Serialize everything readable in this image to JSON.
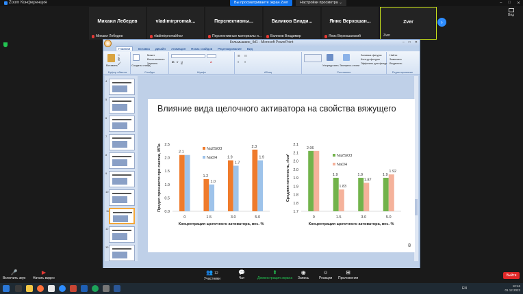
{
  "zoom": {
    "app_title": "Zoom Конференция",
    "share_banner": "Вы просматриваете экран Zver",
    "view_options": "Настройки просмотра ⌄",
    "view_label": "Вид",
    "participants": [
      {
        "display": "Михаил Лебедев",
        "name": "Михаил Лебедев",
        "muted": true
      },
      {
        "display": "vladimirpromak...",
        "name": "vladimirpromakhov",
        "muted": true
      },
      {
        "display": "Перспективны...",
        "name": "Перспективные материалы и...",
        "muted": true
      },
      {
        "display": "Валиков Влади...",
        "name": "Валиков Владимир",
        "muted": true
      },
      {
        "display": "Янис Верхошан...",
        "name": "Янис Верхошанский",
        "muted": true
      },
      {
        "display": "Zver",
        "name": "Zver",
        "muted": false
      }
    ],
    "controls": {
      "unmute": "Включить звук",
      "start_video": "Начать видео",
      "participants": "Участники",
      "participants_count": "12",
      "chat": "Чат",
      "share": "Демонстрация экрана",
      "record": "Запись",
      "reactions": "Реакции",
      "apps": "Приложения",
      "leave": "Выйти"
    }
  },
  "powerpoint": {
    "window_title": "Кольмышкин_4d1 - Microsoft PowerPoint",
    "tabs": [
      "Главная",
      "Вставка",
      "Дизайн",
      "Анимация",
      "Показ слайдов",
      "Рецензирование",
      "Вид"
    ],
    "ribbon": {
      "paste": "Вставить",
      "cut": "Вырезать",
      "copy": "Копировать",
      "format": "Формат по образцу",
      "clipboard_group": "Буфер обмена",
      "create_slide": "Создать слайд",
      "layout": "Макет",
      "reset": "Восстановить",
      "delete": "Удалить",
      "slides_group": "Слайды",
      "font_group": "Шрифт",
      "paragraph_group": "Абзац",
      "arrange": "Упорядочить",
      "quick_styles": "Экспресс-стили",
      "fill": "Заливка фигуры",
      "outline": "Контур фигуры",
      "effects": "Эффекты для фигур",
      "drawing_group": "Рисование",
      "find": "Найти",
      "replace": "Заменить",
      "select": "Выделить",
      "editing_group": "Редактирование"
    },
    "slide_numbers": [
      "4",
      "5",
      "6",
      "7",
      "8",
      "9",
      "10",
      "11",
      "12",
      "13",
      "14"
    ],
    "selected_slide": "11"
  },
  "slide": {
    "title": "Влияние вида щелочного активатора на свойства вяжущего",
    "number": "8"
  },
  "chart_data": [
    {
      "type": "bar",
      "categories": [
        "0",
        "1.5",
        "3.0",
        "5.0"
      ],
      "series": [
        {
          "name": "Na2SiO3",
          "values": [
            2.1,
            1.2,
            1.9,
            2.3
          ],
          "color": "#ef7b2c"
        },
        {
          "name": "NaOH",
          "values": [
            2.1,
            1.0,
            1.7,
            1.9
          ],
          "color": "#9ec3ea"
        }
      ],
      "data_labels": [
        [
          "2.1",
          "1.2",
          "1.9",
          "2.3"
        ],
        [
          "",
          "1.0",
          "1.7",
          "1.9"
        ]
      ],
      "xlabel": "Концентрация щелочного активатора, вес. %",
      "ylabel": "Предел прочности при сжатии, МПа",
      "ylim": [
        0,
        2.5
      ],
      "yticks": [
        "0.0",
        "0.5",
        "1.0",
        "1.5",
        "2.0",
        "2.5"
      ],
      "legend": "top-left"
    },
    {
      "type": "bar",
      "categories": [
        "0",
        "1.5",
        "3.0",
        "5.0"
      ],
      "series": [
        {
          "name": "Na2SiO3",
          "values": [
            2.06,
            1.9,
            1.9,
            1.9
          ],
          "color": "#72b34b"
        },
        {
          "name": "NaOH",
          "values": [
            2.06,
            1.83,
            1.87,
            1.92
          ],
          "color": "#f5b29b"
        }
      ],
      "data_labels": [
        [
          "2.06",
          "1.9",
          "1.9",
          "1.9"
        ],
        [
          "",
          "1.83",
          "1.87",
          "1.92"
        ]
      ],
      "xlabel": "Концентрация щелочного активатора, вес. %",
      "ylabel": "Средняя плотность, г/см³",
      "ylim": [
        1.7,
        2.1
      ],
      "yticks": [
        "1.7",
        "1.8",
        "1.8",
        "1.9",
        "1.9",
        "2.0",
        "2.0",
        "2.1",
        "2.1"
      ],
      "legend": "top-left"
    }
  ],
  "taskbar": {
    "lang": "EN",
    "time": "10:46",
    "date": "01.12.2022"
  }
}
